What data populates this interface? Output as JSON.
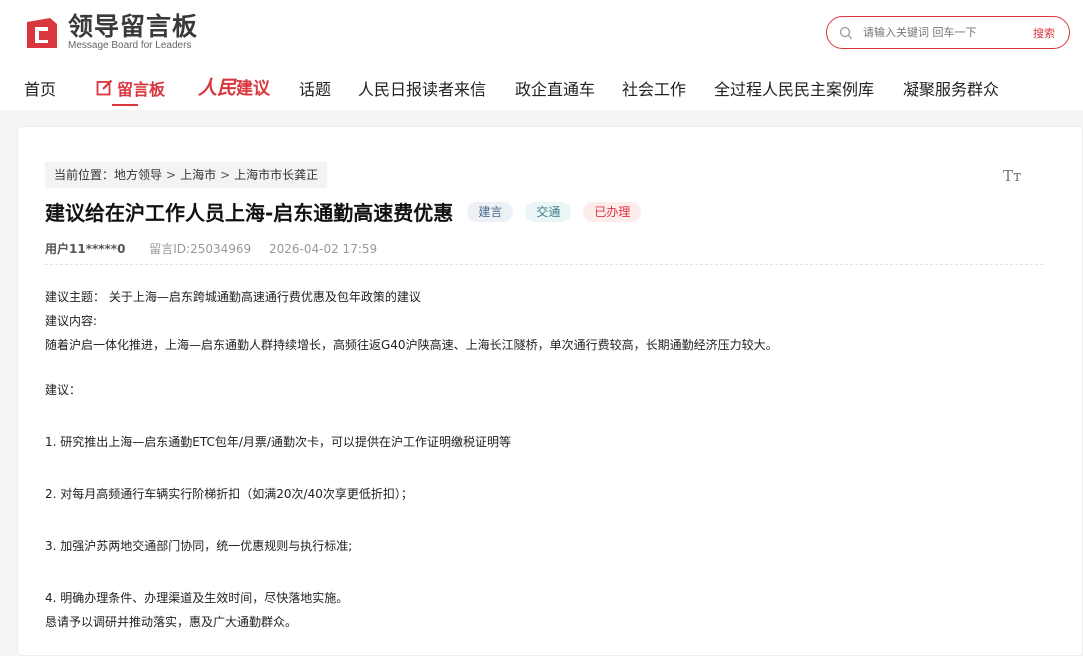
{
  "header": {
    "logo_title": "领导留言板",
    "logo_subtitle": "Message Board for Leaders",
    "search_placeholder": "请输入关键词 回车一下",
    "search_button": "搜索"
  },
  "nav": {
    "home": "首页",
    "message_board": "留言板",
    "renmin_jianyi_script": "人民",
    "renmin_jianyi": "建议",
    "topics": "话题",
    "readers_letters": "人民日报读者来信",
    "gov_enterprise": "政企直通车",
    "social_work": "社会工作",
    "democracy_cases": "全过程人民民主案例库",
    "serve_masses": "凝聚服务群众"
  },
  "breadcrumb": {
    "prefix": "当前位置：",
    "level1": "地方领导",
    "level2": "上海市",
    "level3": "上海市市长龚正",
    "separator": ">"
  },
  "font_size_icon": "Tт",
  "post": {
    "title": "建议给在沪工作人员上海-启东通勤高速费优惠",
    "tags": [
      "建言",
      "交通",
      "已办理"
    ],
    "user": "用户11*****0",
    "message_id": "留言ID:25034969",
    "datetime": "2026-04-02 17:59",
    "lines": [
      "建议主题： 关于上海—启东跨城通勤高速通行费优惠及包年政策的建议",
      "建议内容:",
      "随着沪启一体化推进，上海—启东通勤人群持续增长，高频往返G40沪陕高速、上海长江隧桥，单次通行费较高，长期通勤经济压力较大。",
      "建议：",
      "1. 研究推出上海—启东通勤ETC包年/月票/通勤次卡，可以提供在沪工作证明缴税证明等",
      "2. 对每月高频通行车辆实行阶梯折扣（如满20次/40次享更低折扣）；",
      "3. 加强沪苏两地交通部门协同，统一优惠规则与执行标准;",
      "4. 明确办理条件、办理渠道及生效时间，尽快落地实施。",
      "恳请予以调研并推动落实，惠及广大通勤群众。"
    ]
  },
  "colors": {
    "accent": "#d9363e",
    "background": "#f4f5f7"
  }
}
